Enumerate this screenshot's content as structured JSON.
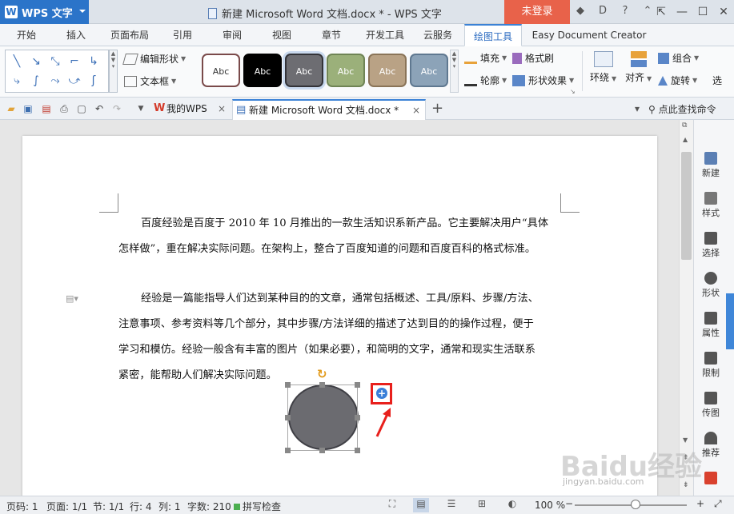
{
  "titlebar": {
    "app_button": "WPS 文字",
    "title": "新建 Microsoft Word 文档.docx * - WPS 文字",
    "login": "未登录",
    "help": "?"
  },
  "tabs": [
    "开始",
    "插入",
    "页面布局",
    "引用",
    "审阅",
    "视图",
    "章节",
    "开发工具",
    "云服务",
    "绘图工具",
    "Easy Document Creator"
  ],
  "active_tab": "绘图工具",
  "ribbon": {
    "edit_shape": "编辑形状",
    "text_box": "文本框",
    "style_label": "Abc",
    "fill": "填充",
    "format_brush": "格式刷",
    "outline": "轮廓",
    "shape_effect": "形状效果",
    "wrap": "环绕",
    "align": "对齐",
    "group": "组合",
    "rotate": "旋转",
    "select": "选",
    "swatches": [
      {
        "bg": "#ffffff",
        "border": "#7a4a4a",
        "text": "#333333"
      },
      {
        "bg": "#000000",
        "border": "#000000",
        "text": "#ffffff"
      },
      {
        "bg": "#6d6d72",
        "border": "#333338",
        "text": "#ffffff"
      },
      {
        "bg": "#9bb07a",
        "border": "#6f8455",
        "text": "#ffffff"
      },
      {
        "bg": "#b9a285",
        "border": "#8a7458",
        "text": "#ffffff"
      },
      {
        "bg": "#8ca3b8",
        "border": "#5f7890",
        "text": "#ffffff"
      }
    ]
  },
  "qbar": {
    "tab_mywps": "我的WPS",
    "tab_doc": "新建 Microsoft Word 文档.docx *",
    "close": "×",
    "find": "点此查找命令"
  },
  "document": {
    "para1_line1": "百度经验是百度于 2010 年 10 月推出的一款生活知识系新产品。它主要解决用户“具体",
    "para1_line2": "怎样做”，重在解决实际问题。在架构上，整合了百度知道的问题和百度百科的格式标准。",
    "para2_line1": "经验是一篇能指导人们达到某种目的的文章，通常包括概述、工具/原料、步骤/方法、",
    "para2_line2": "注意事项、参考资料等几个部分，其中步骤/方法详细的描述了达到目的的操作过程，便于",
    "para2_line3": "学习和模仿。经验一般含有丰富的图片（如果必要），和简明的文字，通常和现实生活联系",
    "para2_line4": "紧密，能帮助人们解决实际问题。"
  },
  "rightbar": [
    {
      "label": "新建",
      "icon": "new-doc-icon"
    },
    {
      "label": "样式",
      "icon": "style-icon"
    },
    {
      "label": "选择",
      "icon": "select-icon"
    },
    {
      "label": "形状",
      "icon": "shape-icon"
    },
    {
      "label": "属性",
      "icon": "property-icon"
    },
    {
      "label": "限制",
      "icon": "restrict-icon"
    },
    {
      "label": "传图",
      "icon": "upload-image-icon"
    },
    {
      "label": "推荐",
      "icon": "recommend-icon"
    }
  ],
  "status": {
    "page_code": "页码: 1",
    "page": "页面: 1/1",
    "section": "节: 1/1",
    "row": "行: 4",
    "col": "列: 1",
    "words": "字数: 210",
    "spell": "拼写检查",
    "zoom": "100 %"
  },
  "watermark": {
    "text": "Baidu经验",
    "sub": "jingyan.baidu.com"
  },
  "colors": {
    "accent": "#2b74c9",
    "login": "#e8624a",
    "highlight": "#e8201c",
    "shape_fill": "#6b6b70"
  }
}
